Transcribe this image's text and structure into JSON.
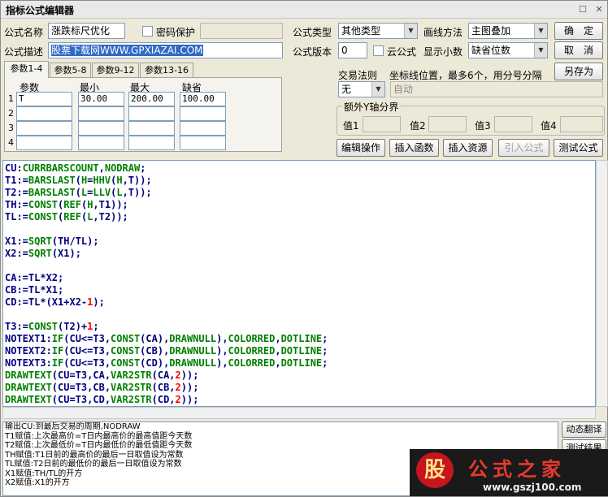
{
  "window": {
    "title": "指标公式编辑器"
  },
  "form": {
    "name_label": "公式名称",
    "name_value": "涨跌标尺优化",
    "password_label": "密码保护",
    "desc_label": "公式描述",
    "desc_value": "股票下载网WWW.GPXIAZAI.COM",
    "type_label": "公式类型",
    "type_value": "其他类型",
    "draw_label": "画线方法",
    "draw_value": "主图叠加",
    "version_label": "公式版本",
    "version_value": "0",
    "cloud_label": "云公式",
    "decimals_label": "显示小数",
    "decimals_value": "缺省位数",
    "trade_label": "交易法则",
    "trade_value": "无",
    "coord_label": "坐标线位置，最多6个，用分号分隔",
    "coord_value": "自动",
    "yaxis_label": "额外Y轴分界",
    "y_labels": [
      "值1",
      "值2",
      "值3",
      "值4"
    ]
  },
  "buttons": {
    "ok": "确　定",
    "cancel": "取　消",
    "save_as": "另存为",
    "edit_ops": "编辑操作",
    "insert_func": "插入函数",
    "insert_res": "插入资源",
    "import": "引入公式",
    "test": "测试公式",
    "translate": "动态翻译",
    "test_result": "测试结果"
  },
  "tabs": [
    "参数1-4",
    "参数5-8",
    "参数9-12",
    "参数13-16"
  ],
  "params": {
    "headers": [
      "参数",
      "最小",
      "最大",
      "缺省"
    ],
    "rows": [
      {
        "idx": "1",
        "name": "T",
        "min": "30.00",
        "max": "200.00",
        "def": "100.00"
      },
      {
        "idx": "2",
        "name": "",
        "min": "",
        "max": "",
        "def": ""
      },
      {
        "idx": "3",
        "name": "",
        "min": "",
        "max": "",
        "def": ""
      },
      {
        "idx": "4",
        "name": "",
        "min": "",
        "max": "",
        "def": ""
      }
    ]
  },
  "code": [
    [
      [
        "CU:",
        0
      ],
      [
        "CURRBARSCOUNT",
        1
      ],
      [
        ",",
        0
      ],
      [
        "NODRAW",
        1
      ],
      [
        ";",
        0
      ]
    ],
    [
      [
        "T1:=",
        0
      ],
      [
        "BARSLAST",
        1
      ],
      [
        "(",
        0
      ],
      [
        "H",
        1
      ],
      [
        "=",
        0
      ],
      [
        "HHV",
        1
      ],
      [
        "(",
        0
      ],
      [
        "H",
        1
      ],
      [
        ",T));",
        0
      ]
    ],
    [
      [
        "T2:=",
        0
      ],
      [
        "BARSLAST",
        1
      ],
      [
        "(",
        0
      ],
      [
        "L",
        1
      ],
      [
        "=",
        0
      ],
      [
        "LLV",
        1
      ],
      [
        "(",
        0
      ],
      [
        "L",
        1
      ],
      [
        ",T));",
        0
      ]
    ],
    [
      [
        "TH:=",
        0
      ],
      [
        "CONST",
        1
      ],
      [
        "(",
        0
      ],
      [
        "REF",
        1
      ],
      [
        "(",
        0
      ],
      [
        "H",
        1
      ],
      [
        ",T1));",
        0
      ]
    ],
    [
      [
        "TL:=",
        0
      ],
      [
        "CONST",
        1
      ],
      [
        "(",
        0
      ],
      [
        "REF",
        1
      ],
      [
        "(",
        0
      ],
      [
        "L",
        1
      ],
      [
        ",T2));",
        0
      ]
    ],
    [
      [
        "",
        0
      ]
    ],
    [
      [
        "X1:=",
        0
      ],
      [
        "SQRT",
        1
      ],
      [
        "(TH/TL);",
        0
      ]
    ],
    [
      [
        "X2:=",
        0
      ],
      [
        "SQRT",
        1
      ],
      [
        "(X1);",
        0
      ]
    ],
    [
      [
        "",
        0
      ]
    ],
    [
      [
        "CA:=TL*X2;",
        0
      ]
    ],
    [
      [
        "CB:=TL*X1;",
        0
      ]
    ],
    [
      [
        "CD:=TL*(X1+X2-",
        0
      ],
      [
        "1",
        2
      ],
      [
        ");",
        0
      ]
    ],
    [
      [
        "",
        0
      ]
    ],
    [
      [
        "T3:=",
        0
      ],
      [
        "CONST",
        1
      ],
      [
        "(T2)+",
        0
      ],
      [
        "1",
        2
      ],
      [
        ";",
        0
      ]
    ],
    [
      [
        "NOTEXT1:",
        0
      ],
      [
        "IF",
        1
      ],
      [
        "(CU<=T3,",
        0
      ],
      [
        "CONST",
        1
      ],
      [
        "(CA),",
        0
      ],
      [
        "DRAWNULL",
        1
      ],
      [
        "),",
        0
      ],
      [
        "COLORRED",
        1
      ],
      [
        ",",
        0
      ],
      [
        "DOTLINE",
        1
      ],
      [
        ";",
        0
      ]
    ],
    [
      [
        "NOTEXT2:",
        0
      ],
      [
        "IF",
        1
      ],
      [
        "(CU<=T3,",
        0
      ],
      [
        "CONST",
        1
      ],
      [
        "(CB),",
        0
      ],
      [
        "DRAWNULL",
        1
      ],
      [
        "),",
        0
      ],
      [
        "COLORRED",
        1
      ],
      [
        ",",
        0
      ],
      [
        "DOTLINE",
        1
      ],
      [
        ";",
        0
      ]
    ],
    [
      [
        "NOTEXT3:",
        0
      ],
      [
        "IF",
        1
      ],
      [
        "(CU<=T3,",
        0
      ],
      [
        "CONST",
        1
      ],
      [
        "(CD),",
        0
      ],
      [
        "DRAWNULL",
        1
      ],
      [
        "),",
        0
      ],
      [
        "COLORRED",
        1
      ],
      [
        ",",
        0
      ],
      [
        "DOTLINE",
        1
      ],
      [
        ";",
        0
      ]
    ],
    [
      [
        "DRAWTEXT",
        1
      ],
      [
        "(CU=T3,CA,",
        0
      ],
      [
        "VAR2STR",
        1
      ],
      [
        "(CA,",
        0
      ],
      [
        "2",
        2
      ],
      [
        "));",
        0
      ]
    ],
    [
      [
        "DRAWTEXT",
        1
      ],
      [
        "(CU=T3,CB,",
        0
      ],
      [
        "VAR2STR",
        1
      ],
      [
        "(CB,",
        0
      ],
      [
        "2",
        2
      ],
      [
        "));",
        0
      ]
    ],
    [
      [
        "DRAWTEXT",
        1
      ],
      [
        "(CU=T3,CD,",
        0
      ],
      [
        "VAR2STR",
        1
      ],
      [
        "(CD,",
        0
      ],
      [
        "2",
        2
      ],
      [
        "));",
        0
      ]
    ]
  ],
  "code_colors": [
    "#000080",
    "#008000",
    "#ff0000"
  ],
  "help_lines": [
    "输出CU:到最后交易的周期,NODRAW",
    "T1赋值:上次最高价=T日内最高价的最高值距今天数",
    "T2赋值:上次最低价=T日内最低价的最低值距今天数",
    "TH赋值:T1日前的最高价的最后一日取值设为常数",
    "TL赋值:T2日前的最低价的最后一日取值设为常数",
    "X1赋值:TH/TL的开方",
    "X2赋值:X1的开方"
  ],
  "watermark": {
    "logo_char": "股",
    "brand": "公式之家",
    "url": "www.gszj100.com"
  }
}
